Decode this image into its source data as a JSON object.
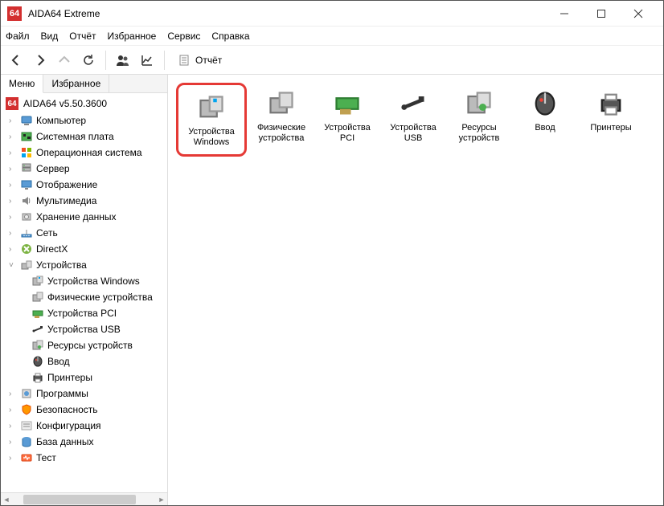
{
  "titlebar": {
    "title": "AIDA64 Extreme",
    "icon_text": "64"
  },
  "menubar": [
    "Файл",
    "Вид",
    "Отчёт",
    "Избранное",
    "Сервис",
    "Справка"
  ],
  "toolbar": {
    "report_label": "Отчёт"
  },
  "side_tabs": {
    "menu": "Меню",
    "fav": "Избранное"
  },
  "tree": {
    "root": "AIDA64 v5.50.3600",
    "items": [
      {
        "label": "Компьютер",
        "icon": "computer",
        "expanded": false
      },
      {
        "label": "Системная плата",
        "icon": "board",
        "expanded": false
      },
      {
        "label": "Операционная система",
        "icon": "os",
        "expanded": false
      },
      {
        "label": "Сервер",
        "icon": "server",
        "expanded": false
      },
      {
        "label": "Отображение",
        "icon": "display",
        "expanded": false
      },
      {
        "label": "Мультимедиа",
        "icon": "speaker",
        "expanded": false
      },
      {
        "label": "Хранение данных",
        "icon": "storage",
        "expanded": false
      },
      {
        "label": "Сеть",
        "icon": "network",
        "expanded": false
      },
      {
        "label": "DirectX",
        "icon": "directx",
        "expanded": false
      },
      {
        "label": "Устройства",
        "icon": "devices",
        "expanded": true,
        "children": [
          {
            "label": "Устройства Windows",
            "icon": "dev-win"
          },
          {
            "label": "Физические устройства",
            "icon": "dev-phys"
          },
          {
            "label": "Устройства PCI",
            "icon": "dev-pci"
          },
          {
            "label": "Устройства USB",
            "icon": "dev-usb"
          },
          {
            "label": "Ресурсы устройств",
            "icon": "dev-res"
          },
          {
            "label": "Ввод",
            "icon": "dev-input"
          },
          {
            "label": "Принтеры",
            "icon": "dev-print"
          }
        ]
      },
      {
        "label": "Программы",
        "icon": "programs",
        "expanded": false
      },
      {
        "label": "Безопасность",
        "icon": "security",
        "expanded": false
      },
      {
        "label": "Конфигурация",
        "icon": "config",
        "expanded": false
      },
      {
        "label": "База данных",
        "icon": "db",
        "expanded": false
      },
      {
        "label": "Тест",
        "icon": "test",
        "expanded": false
      }
    ]
  },
  "content_items": [
    {
      "label": "Устройства Windows",
      "icon": "dev-win",
      "highlighted": true
    },
    {
      "label": "Физические устройства",
      "icon": "dev-phys"
    },
    {
      "label": "Устройства PCI",
      "icon": "dev-pci"
    },
    {
      "label": "Устройства USB",
      "icon": "dev-usb"
    },
    {
      "label": "Ресурсы устройств",
      "icon": "dev-res"
    },
    {
      "label": "Ввод",
      "icon": "dev-input"
    },
    {
      "label": "Принтеры",
      "icon": "dev-print"
    }
  ]
}
